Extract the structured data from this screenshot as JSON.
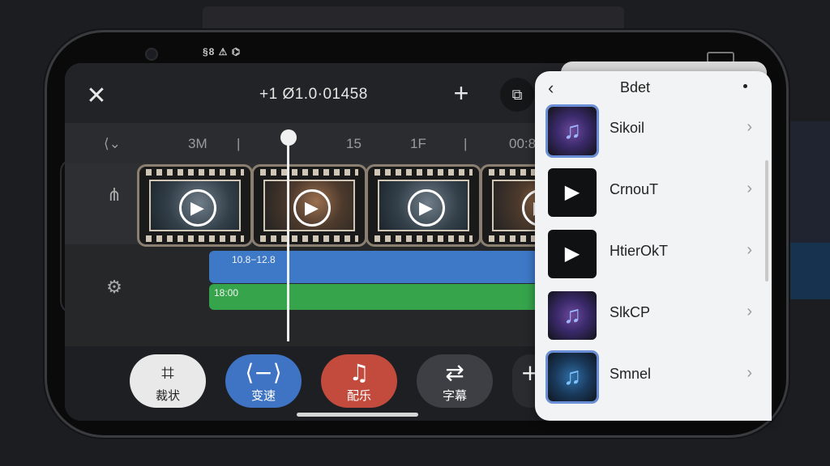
{
  "status": {
    "left": "§8 ⚠ ⌬"
  },
  "editor": {
    "timecode": "+1 Ø1.0·01458",
    "ruler": [
      "3M",
      "|",
      "15",
      "1F",
      "|",
      "00:8"
    ],
    "tracks": {
      "blue_label": "10.8−12.8",
      "green_label": "18:00"
    },
    "tools": [
      {
        "icon": "crop-icon",
        "label": "裁状",
        "color": "#e9e9e9",
        "text_color": "#1f1f1f"
      },
      {
        "icon": "speed-icon",
        "label": "变速",
        "color": "#3f73c4",
        "text_color": "#ffffff"
      },
      {
        "icon": "music-note-icon",
        "label": "配乐",
        "color": "#c24b3e",
        "text_color": "#ffffff"
      },
      {
        "icon": "adjust-icon",
        "label": "字幕",
        "color": "#3d3f45",
        "text_color": "#ffffff"
      },
      {
        "icon": "plus-icon",
        "label": "",
        "color": "#2b2c2f",
        "text_color": "#ffffff"
      }
    ]
  },
  "panel": {
    "title": "Bdet",
    "items": [
      {
        "label": "Sikoil",
        "thumb": "music-icon"
      },
      {
        "label": "CrnouT",
        "thumb": "play-icon"
      },
      {
        "label": "HtierOkT",
        "thumb": "play-icon"
      },
      {
        "label": "SlkCP",
        "thumb": "music-icon"
      },
      {
        "label": "Smnel",
        "thumb": "music-icon"
      }
    ]
  }
}
